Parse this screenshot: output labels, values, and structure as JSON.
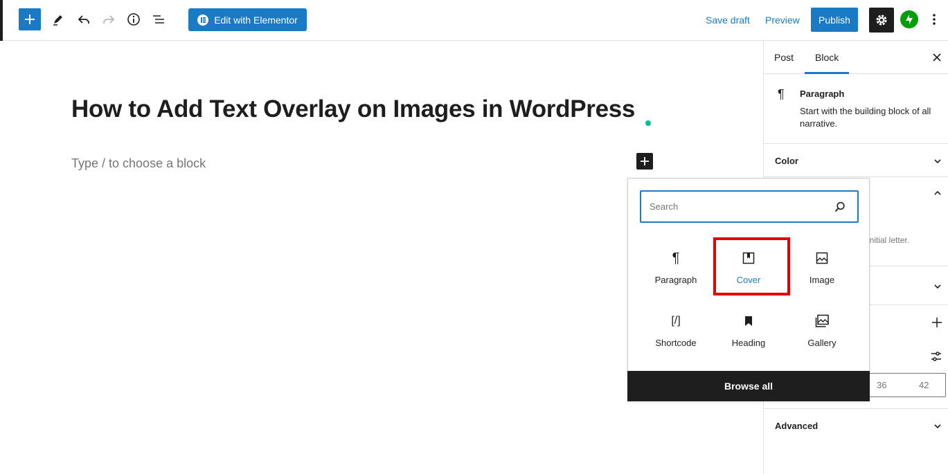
{
  "toolbar": {
    "edit_elementor_label": "Edit with Elementor",
    "save_draft_label": "Save draft",
    "preview_label": "Preview",
    "publish_label": "Publish"
  },
  "editor": {
    "post_title": "How to Add Text Overlay on Images in WordPress",
    "block_placeholder": "Type / to choose a block"
  },
  "sidebar": {
    "tabs": [
      {
        "label": "Post"
      },
      {
        "label": "Block"
      }
    ],
    "block_card": {
      "name": "Paragraph",
      "description": "Start with the building block of all narrative."
    },
    "panels": {
      "color": "Color",
      "advanced": "Advanced"
    },
    "partial_text": "initial letter.",
    "font_sizes": [
      "36",
      "42"
    ]
  },
  "inserter": {
    "search_placeholder": "Search",
    "blocks": [
      {
        "label": "Paragraph",
        "icon": "paragraph-icon"
      },
      {
        "label": "Cover",
        "icon": "cover-icon"
      },
      {
        "label": "Image",
        "icon": "image-icon"
      },
      {
        "label": "Shortcode",
        "icon": "shortcode-icon"
      },
      {
        "label": "Heading",
        "icon": "heading-icon"
      },
      {
        "label": "Gallery",
        "icon": "gallery-icon"
      }
    ],
    "browse_all_label": "Browse all"
  },
  "colors": {
    "accent": "#1a7ac3",
    "highlight": "#e10000",
    "dark": "#1e1e1e",
    "jetpack": "#069e08"
  }
}
